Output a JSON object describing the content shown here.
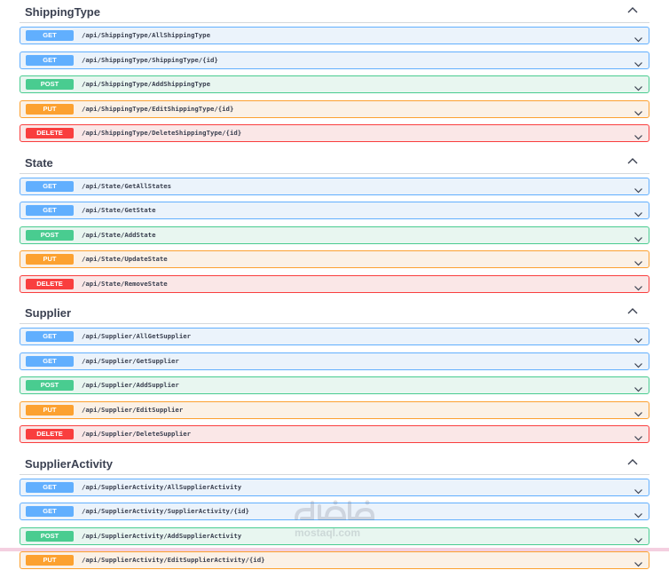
{
  "sections": [
    {
      "title": "ShippingType",
      "operations": [
        {
          "method": "GET",
          "path": "/api/ShippingType/AllShippingType"
        },
        {
          "method": "GET",
          "path": "/api/ShippingType/ShippingType/{id}"
        },
        {
          "method": "POST",
          "path": "/api/ShippingType/AddShippingType"
        },
        {
          "method": "PUT",
          "path": "/api/ShippingType/EditShippingType/{id}"
        },
        {
          "method": "DELETE",
          "path": "/api/ShippingType/DeleteShippingType/{id}"
        }
      ]
    },
    {
      "title": "State",
      "operations": [
        {
          "method": "GET",
          "path": "/api/State/GetAllStates"
        },
        {
          "method": "GET",
          "path": "/api/State/GetState"
        },
        {
          "method": "POST",
          "path": "/api/State/AddState"
        },
        {
          "method": "PUT",
          "path": "/api/State/UpdateState"
        },
        {
          "method": "DELETE",
          "path": "/api/State/RemoveState"
        }
      ]
    },
    {
      "title": "Supplier",
      "operations": [
        {
          "method": "GET",
          "path": "/api/Supplier/AllGetSupplier"
        },
        {
          "method": "GET",
          "path": "/api/Supplier/GetSupplier"
        },
        {
          "method": "POST",
          "path": "/api/Supplier/AddSupplier"
        },
        {
          "method": "PUT",
          "path": "/api/Supplier/EditSupplier"
        },
        {
          "method": "DELETE",
          "path": "/api/Supplier/DeleteSupplier"
        }
      ]
    },
    {
      "title": "SupplierActivity",
      "operations": [
        {
          "method": "GET",
          "path": "/api/SupplierActivity/AllSupplierActivity"
        },
        {
          "method": "GET",
          "path": "/api/SupplierActivity/SupplierActivity/{id}"
        },
        {
          "method": "POST",
          "path": "/api/SupplierActivity/AddSupplierActivity"
        },
        {
          "method": "PUT",
          "path": "/api/SupplierActivity/EditSupplierActivity/{id}"
        }
      ]
    }
  ],
  "watermark": {
    "text": "mostaql.com"
  },
  "colors": {
    "get": "#61affe",
    "post": "#49cc90",
    "put": "#fca130",
    "delete": "#f93e3e",
    "text": "#3b4151"
  },
  "icons": {
    "section_toggle": "chevron-up-icon",
    "operation_toggle": "chevron-down-icon"
  }
}
